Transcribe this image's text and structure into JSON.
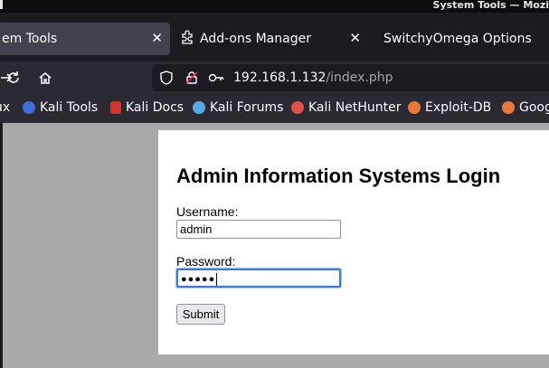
{
  "window": {
    "title": "System Tools — Mozi"
  },
  "tabs": [
    {
      "label": "em Tools",
      "active": true
    },
    {
      "label": "Add-ons Manager",
      "active": false
    },
    {
      "label": "SwitchyOmega Options",
      "active": false
    }
  ],
  "url": {
    "host": "192.168.1.132",
    "path": "/index.php"
  },
  "bookmarks": [
    {
      "label": "ux",
      "icon": "kali-icon"
    },
    {
      "label": "Kali Tools",
      "icon": "kali-tools-icon",
      "color": "#3b6fd6"
    },
    {
      "label": "Kali Docs",
      "icon": "kali-docs-icon",
      "color": "#d0342c"
    },
    {
      "label": "Kali Forums",
      "icon": "kali-dragon-icon",
      "color": "#5aa9e6"
    },
    {
      "label": "Kali NetHunter",
      "icon": "nethunter-icon",
      "color": "#e0504a"
    },
    {
      "label": "Exploit-DB",
      "icon": "exploitdb-icon",
      "color": "#e8793a"
    },
    {
      "label": "Goog",
      "icon": "ghdb-icon",
      "color": "#e8793a"
    }
  ],
  "page": {
    "heading": "Admin Information Systems Login",
    "username_label": "Username:",
    "username_value": "admin",
    "password_label": "Password:",
    "password_mask": "●●●●●",
    "submit_label": "Submit"
  }
}
